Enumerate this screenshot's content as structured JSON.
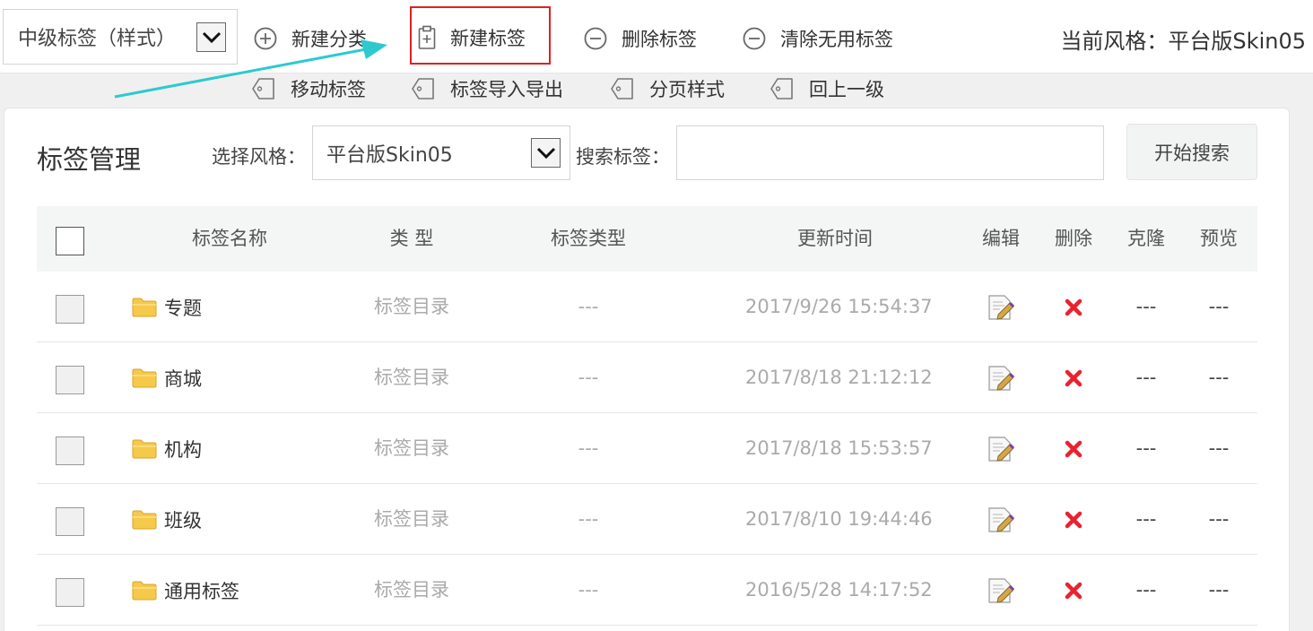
{
  "toolbar": {
    "level_select": "中级标签（样式）",
    "new_category": "新建分类",
    "new_tag": "新建标签",
    "delete_tag": "删除标签",
    "clear_unused": "清除无用标签",
    "current_style": "当前风格：平台版Skin05",
    "move_tag": "移动标签",
    "import_export": "标签导入导出",
    "pagination_style": "分页样式",
    "go_up": "回上一级"
  },
  "panel": {
    "title": "标签管理",
    "style_label": "选择风格：",
    "style_value": "平台版Skin05",
    "search_label": "搜索标签：",
    "search_value": "",
    "search_button": "开始搜索"
  },
  "table": {
    "headers": {
      "name": "标签名称",
      "type": "类 型",
      "tag_type": "标签类型",
      "updated": "更新时间",
      "edit": "编辑",
      "delete": "删除",
      "clone": "克隆",
      "preview": "预览"
    },
    "rows": [
      {
        "name": "专题",
        "type": "标签目录",
        "tag_type": "---",
        "updated": "2017/9/26 15:54:37",
        "clone": "---",
        "preview": "---"
      },
      {
        "name": "商城",
        "type": "标签目录",
        "tag_type": "---",
        "updated": "2017/8/18 21:12:12",
        "clone": "---",
        "preview": "---"
      },
      {
        "name": "机构",
        "type": "标签目录",
        "tag_type": "---",
        "updated": "2017/8/18 15:53:57",
        "clone": "---",
        "preview": "---"
      },
      {
        "name": "班级",
        "type": "标签目录",
        "tag_type": "---",
        "updated": "2017/8/10 19:44:46",
        "clone": "---",
        "preview": "---"
      },
      {
        "name": "通用标签",
        "type": "标签目录",
        "tag_type": "---",
        "updated": "2016/5/28 14:17:52",
        "clone": "---",
        "preview": "---"
      }
    ]
  },
  "colors": {
    "highlight": "#e02020",
    "arrow": "#2ec9cf",
    "delete_icon": "#e8232e",
    "folder": "#f5c94a"
  },
  "icons": {
    "select_dropdown": "chevron-down-icon",
    "new_category": "plus-circle-icon",
    "new_tag": "clipboard-plus-icon",
    "delete_tag": "minus-circle-icon",
    "clear_unused": "minus-circle-icon",
    "move_tag": "tag-icon",
    "import_export": "tag-icon",
    "pagination_style": "tag-icon",
    "go_up": "tag-icon",
    "row_folder": "folder-icon",
    "row_edit": "edit-icon",
    "row_delete": "delete-x-icon"
  }
}
